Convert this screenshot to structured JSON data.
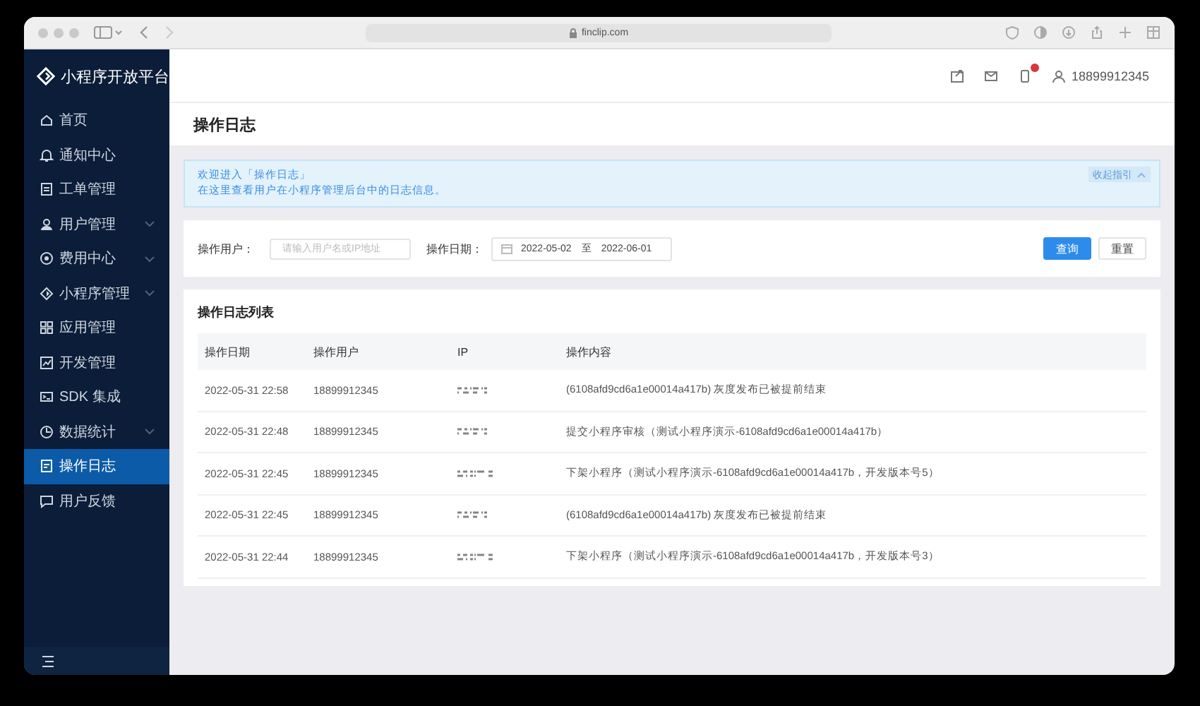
{
  "browser": {
    "url": "finclip.com"
  },
  "sidebar": {
    "title": "小程序开放平台",
    "items": [
      {
        "label": "首页",
        "has_submenu": false,
        "selected": false
      },
      {
        "label": "通知中心",
        "has_submenu": false,
        "selected": false
      },
      {
        "label": "工单管理",
        "has_submenu": false,
        "selected": false
      },
      {
        "label": "用户管理",
        "has_submenu": true,
        "selected": false
      },
      {
        "label": "费用中心",
        "has_submenu": true,
        "selected": false
      },
      {
        "label": "小程序管理",
        "has_submenu": true,
        "selected": false
      },
      {
        "label": "应用管理",
        "has_submenu": false,
        "selected": false
      },
      {
        "label": "开发管理",
        "has_submenu": false,
        "selected": false
      },
      {
        "label": "SDK 集成",
        "has_submenu": false,
        "selected": false
      },
      {
        "label": "数据统计",
        "has_submenu": true,
        "selected": false
      },
      {
        "label": "操作日志",
        "has_submenu": false,
        "selected": true
      },
      {
        "label": "用户反馈",
        "has_submenu": false,
        "selected": false
      }
    ]
  },
  "header": {
    "user": "18899912345"
  },
  "page_title": "操作日志",
  "notice": {
    "lines": [
      "欢迎进入「操作日志」",
      "在这里查看用户在小程序管理后台中的日志信息。"
    ],
    "collapse": "收起指引"
  },
  "filters": {
    "user_label": "操作用户：",
    "user_placeholder": "请输入用户名或IP地址",
    "date_label": "操作日期：",
    "date_start": "2022-05-02",
    "date_separator": "至",
    "date_end": "2022-06-01",
    "buttons": [
      {
        "label": "查询",
        "primary": true
      },
      {
        "label": "重置",
        "primary": false
      }
    ]
  },
  "table": {
    "title": "操作日志列表",
    "columns": [
      "操作日期",
      "操作用户",
      "IP",
      "操作内容"
    ],
    "rows": [
      {
        "date": "2022-05-31 22:58",
        "user": "18899912345",
        "content": "(6108afd9cd6a1e00014a417b) 灰度发布已被提前结束"
      },
      {
        "date": "2022-05-31 22:48",
        "user": "18899912345",
        "content": "提交小程序审核（测试小程序演示-6108afd9cd6a1e00014a417b）"
      },
      {
        "date": "2022-05-31 22:45",
        "user": "18899912345",
        "content": "下架小程序（测试小程序演示-6108afd9cd6a1e00014a417b，开发版本号5）"
      },
      {
        "date": "2022-05-31 22:45",
        "user": "18899912345",
        "content": "(6108afd9cd6a1e00014a417b) 灰度发布已被提前结束"
      },
      {
        "date": "2022-05-31 22:44",
        "user": "18899912345",
        "content": "下架小程序（测试小程序演示-6108afd9cd6a1e00014a417b，开发版本号3）"
      }
    ]
  }
}
